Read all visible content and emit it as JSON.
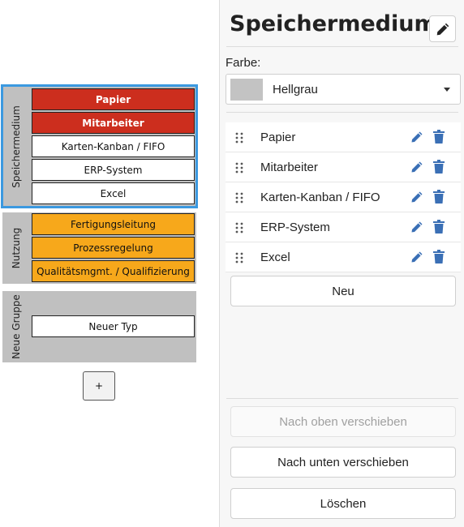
{
  "canvas": {
    "groups": [
      {
        "label": "Speichermedium",
        "items": [
          "Papier",
          "Mitarbeiter",
          "Karten-Kanban / FIFO",
          "ERP-System",
          "Excel"
        ]
      },
      {
        "label": "Nutzung",
        "items": [
          "Fertigungsleitung",
          "Prozessregelung",
          "Qualitätsmgmt. / Qualifizierung"
        ]
      },
      {
        "label": "Neue Gruppe",
        "items": [
          "Neuer Typ"
        ]
      }
    ],
    "add_button_label": "+"
  },
  "panel": {
    "title": "Speichermedium",
    "color_label": "Farbe:",
    "color_value": "Hellgrau",
    "types": [
      "Papier",
      "Mitarbeiter",
      "Karten-Kanban / FIFO",
      "ERP-System",
      "Excel"
    ],
    "new_button": "Neu",
    "move_up_button": "Nach oben verschieben",
    "move_down_button": "Nach unten verschieben",
    "delete_button": "Löschen"
  },
  "colors": {
    "selection": "#3b99e0",
    "red_item": "#cc2e1e",
    "orange_item": "#f7a81b",
    "group_bg": "#c0c0c0",
    "icon_blue": "#3a6fb5",
    "swatch": "#c3c3c3"
  },
  "icons": {
    "title_edit": "pencil-icon",
    "row_edit": "pencil-icon",
    "row_delete": "trash-icon",
    "drag": "drag-handle-icon",
    "dropdown": "caret-down-icon"
  }
}
